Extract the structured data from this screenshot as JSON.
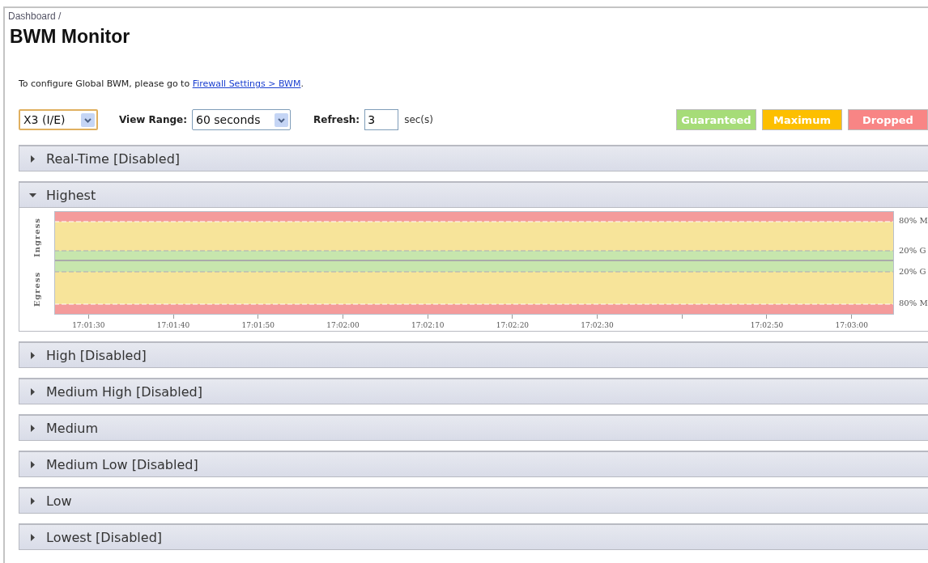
{
  "breadcrumb": "Dashboard /",
  "title": "BWM Monitor",
  "notice": {
    "text": "To configure Global BWM, please go to ",
    "link": "Firewall Settings > BWM",
    "after": "."
  },
  "toolbar": {
    "interface": {
      "value": "X3 (I/E)"
    },
    "view_range": {
      "label": "View Range:",
      "value": "60 seconds"
    },
    "refresh": {
      "label": "Refresh:",
      "value": "3",
      "unit": "sec(s)"
    }
  },
  "legend": [
    {
      "label": "Guaranteed",
      "color": "#a6dc78"
    },
    {
      "label": "Maximum",
      "color": "#fdbf00"
    },
    {
      "label": "Dropped",
      "color": "#f88585"
    }
  ],
  "sections": [
    {
      "title": "Real-Time [Disabled]",
      "expanded": false
    },
    {
      "title": "Highest",
      "expanded": true,
      "graph": {
        "axis_labels": [
          "Ingress",
          "Egress"
        ],
        "right_labels": [
          "80% M",
          "20% G",
          "20% G",
          "80% M"
        ],
        "time_ticks": [
          {
            "kind": "labeled",
            "label": "17:01:30"
          },
          {
            "kind": "labeled",
            "label": "17:01:40"
          },
          {
            "kind": "labeled",
            "label": "17:01:50"
          },
          {
            "kind": "labeled",
            "label": "17:02:00"
          },
          {
            "kind": "labeled",
            "label": "17:02:10"
          },
          {
            "kind": "labeled",
            "label": "17:02:20"
          },
          {
            "kind": "labeled",
            "label": "17:02:30"
          },
          {
            "kind": "unlabeled"
          },
          {
            "kind": "labeled",
            "label": "17:02:50"
          },
          {
            "kind": "labeled",
            "label": "17:03:00"
          }
        ]
      }
    },
    {
      "title": "High [Disabled]",
      "expanded": false
    },
    {
      "title": "Medium High [Disabled]",
      "expanded": false
    },
    {
      "title": "Medium",
      "expanded": false
    },
    {
      "title": "Medium Low [Disabled]",
      "expanded": false
    },
    {
      "title": "Low",
      "expanded": false
    },
    {
      "title": "Lowest [Disabled]",
      "expanded": false
    }
  ]
}
